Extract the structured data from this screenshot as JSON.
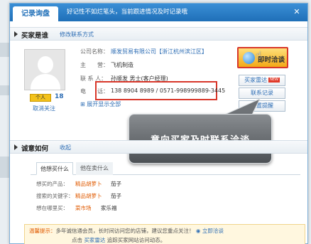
{
  "header": {
    "tab_label": "记录询盘",
    "hint": "好记性不如烂笔头，当前跟进情况及时记录哦"
  },
  "buyer_section": {
    "title": "买家是谁",
    "edit_link": "修改联系方式",
    "badge": "个人",
    "badge_count": "18",
    "unfollow": "取消关注",
    "fields": [
      {
        "label": "公司名称：",
        "value": "顺发贸易有限公司【浙江杭州滨江区】"
      },
      {
        "label": "主　　营：",
        "value": "飞机制造"
      },
      {
        "label": "联 系 人：",
        "value": "孙顺发 男士(客户经理)"
      },
      {
        "label": "电　　话：",
        "value": "138 8904 8989 / 0571-998999889-3445"
      }
    ],
    "expand_link": "展开显示全部",
    "contact_button": "即时洽谈",
    "side_buttons": [
      {
        "label": "买家雷达",
        "tag": "NEW"
      },
      {
        "label": "联系记录",
        "tag": ""
      },
      {
        "label": "设置提醒",
        "tag": ""
      }
    ]
  },
  "callout": {
    "text": "意向买家及时联系洽谈"
  },
  "intent_section": {
    "title": "诚意如何",
    "link": "收起",
    "tabs": [
      "他想买什么",
      "他在卖什么"
    ],
    "rows": [
      {
        "label": "想买的产品：",
        "tag": "精品胡萝卜",
        "value": "茄子"
      },
      {
        "label": "搜索的关键字：",
        "tag": "精品胡萝卜",
        "value": "茄子"
      },
      {
        "label": "想在哪里买：",
        "tag": "菜市场",
        "value": "家乐福"
      }
    ]
  },
  "tip": {
    "prefix": "温馨提示：",
    "line1": "多年诚信通会员，长时间访问您的店铺，建议您重点关注！",
    "action": "立即洽谈",
    "line2_prefix": "点击",
    "line2_link": "买家雷达",
    "line2_suffix": "追踪买家网站访问动态。"
  },
  "colors": {
    "titlebar": "#1f6fb8",
    "link": "#2d6db4",
    "highlight_border": "#d8372a",
    "orange": "#e05a00"
  },
  "icons": [
    "close-icon",
    "avatar-placeholder",
    "wangwang-icon",
    "hand-cursor-icon"
  ]
}
